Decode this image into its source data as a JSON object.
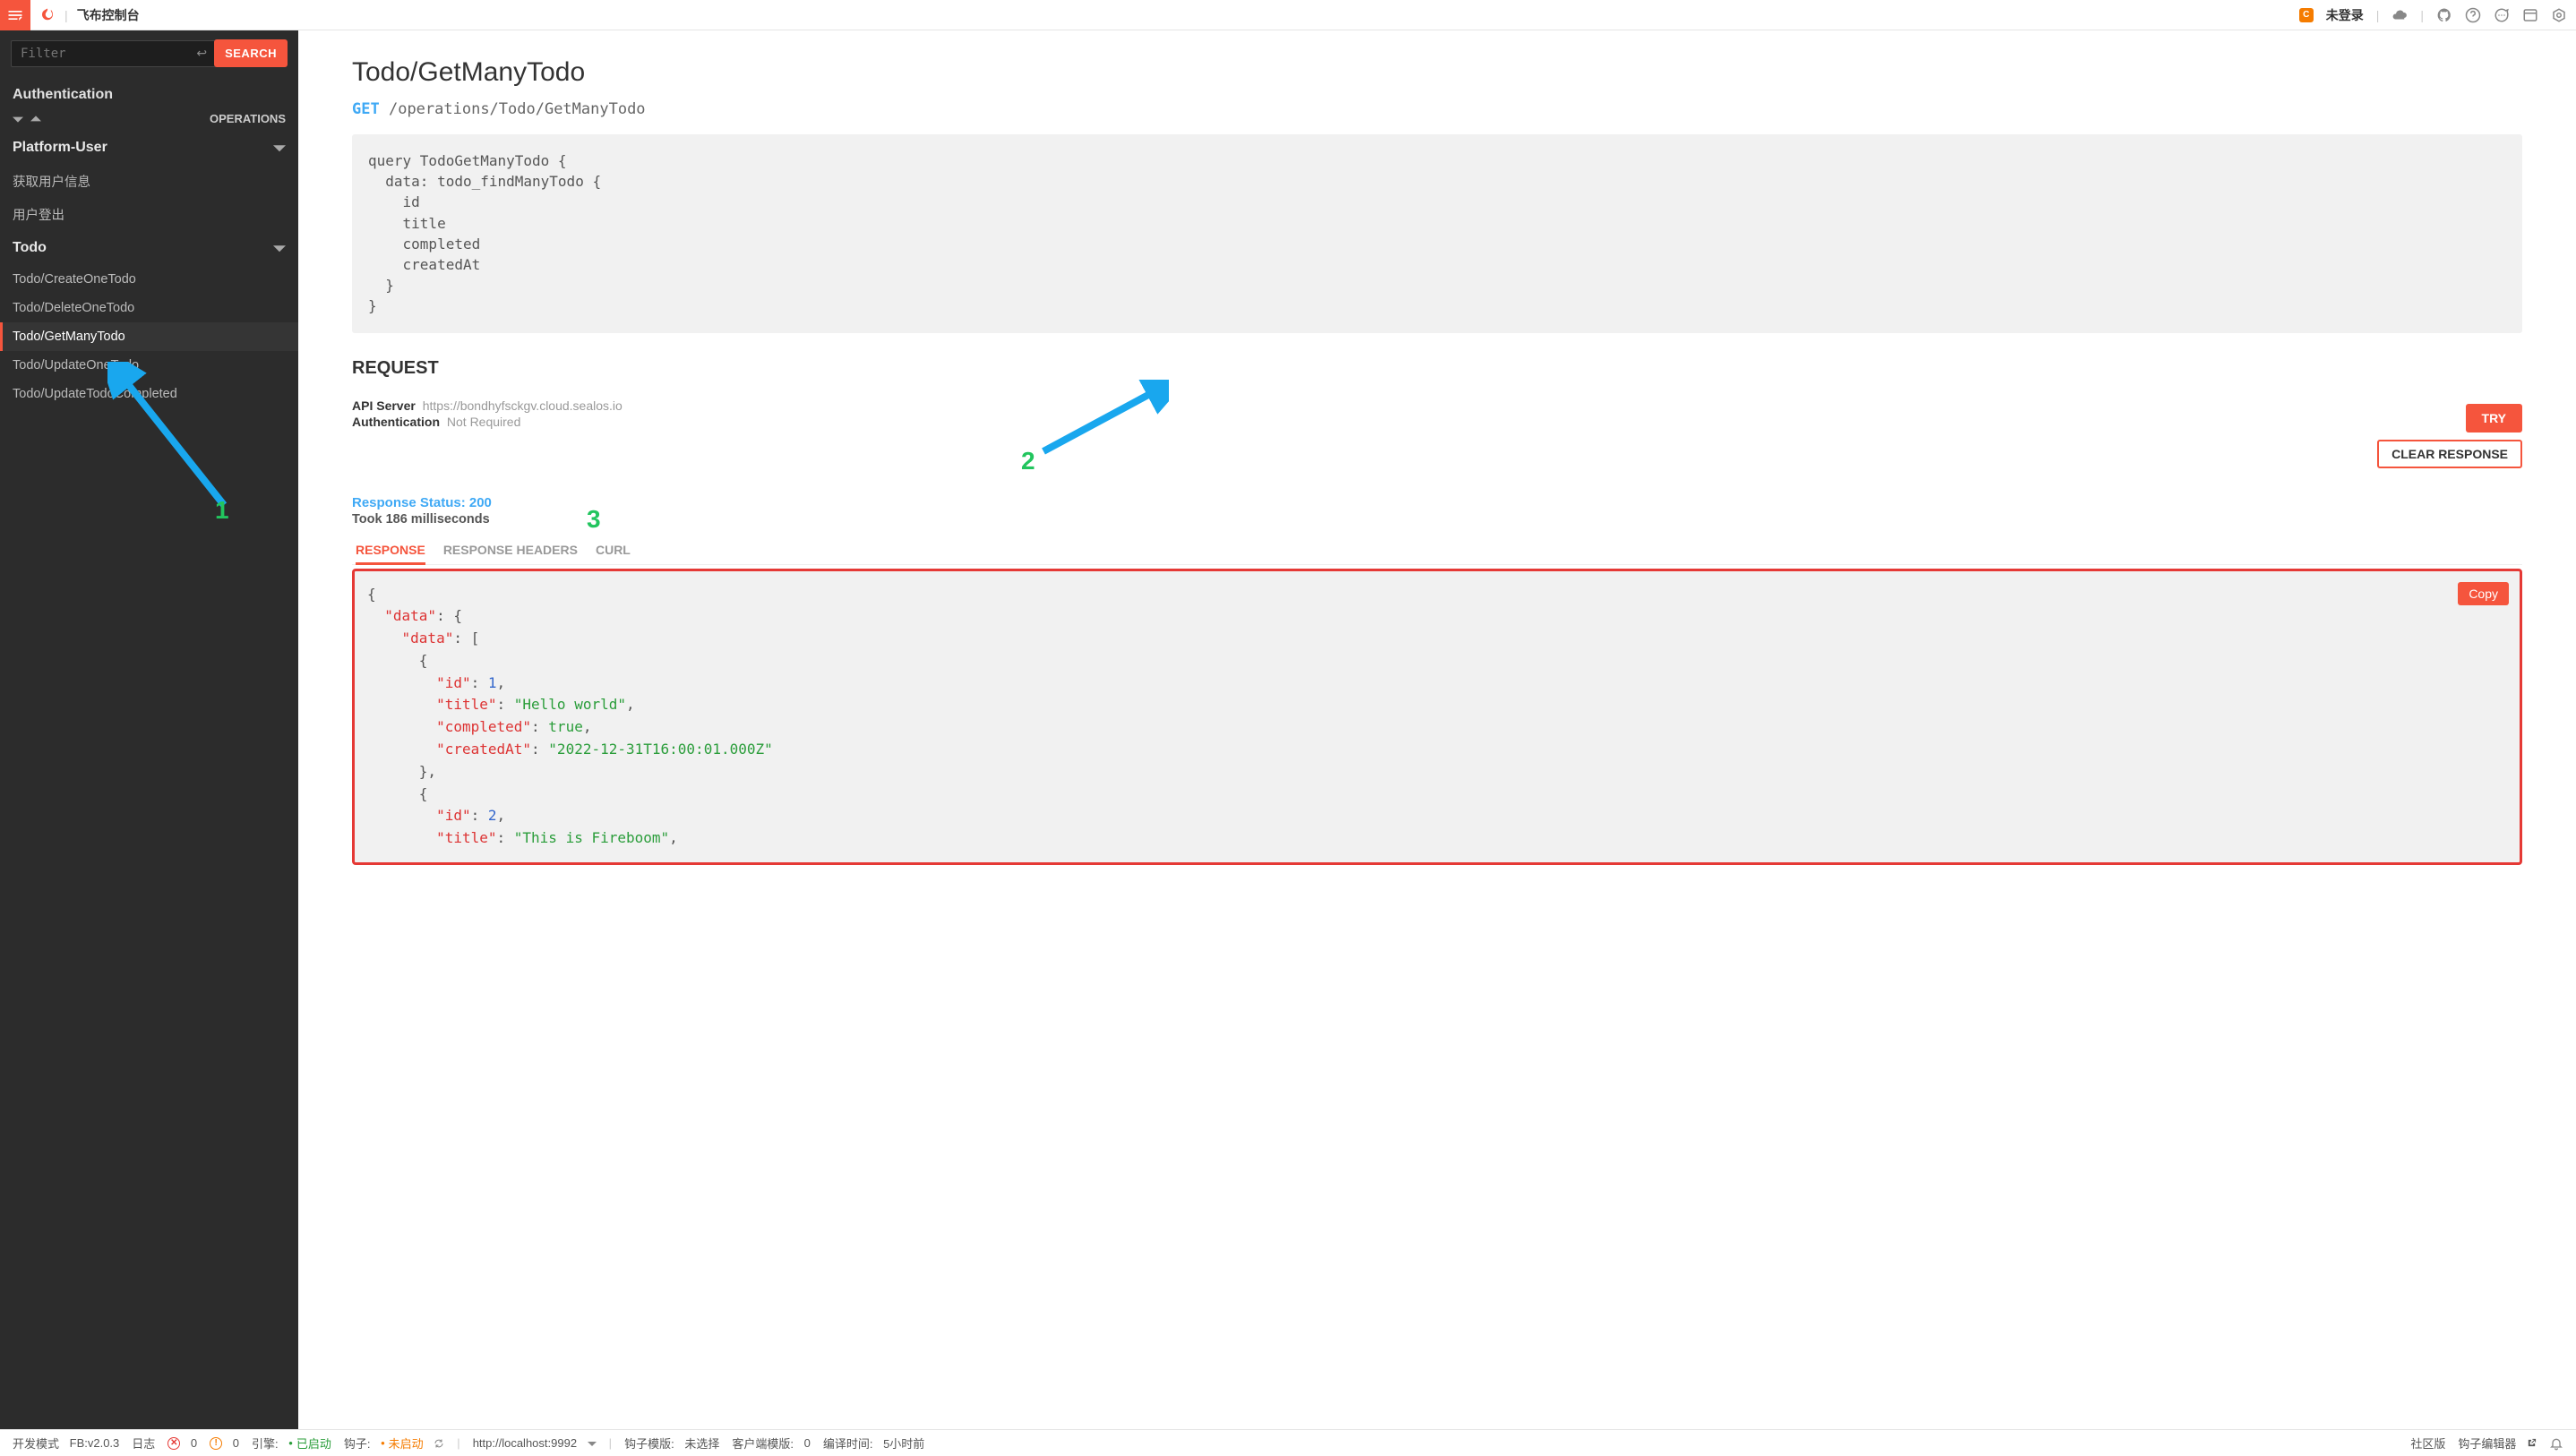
{
  "topbar": {
    "title": "飞布控制台",
    "login_status": "未登录"
  },
  "sidebar": {
    "filter_placeholder": "Filter",
    "search_label": "SEARCH",
    "auth_heading": "Authentication",
    "operations_label": "OPERATIONS",
    "groups": [
      {
        "name": "Platform-User",
        "items": [
          "获取用户信息",
          "用户登出"
        ]
      },
      {
        "name": "Todo",
        "items": [
          "Todo/CreateOneTodo",
          "Todo/DeleteOneTodo",
          "Todo/GetManyTodo",
          "Todo/UpdateOneTodo",
          "Todo/UpdateTodoCompleted"
        ],
        "active_index": 2
      }
    ]
  },
  "main": {
    "page_title": "Todo/GetManyTodo",
    "method": "GET",
    "path": "/operations/Todo/GetManyTodo",
    "query_code": "query TodoGetManyTodo {\n  data: todo_findManyTodo {\n    id\n    title\n    completed\n    createdAt\n  }\n}",
    "request_heading": "REQUEST",
    "api_server_label": "API Server",
    "api_server_value": "https://bondhyfsckgv.cloud.sealos.io",
    "auth_label": "Authentication",
    "auth_value": "Not Required",
    "try_label": "TRY",
    "clear_label": "CLEAR RESPONSE",
    "response_status": "Response Status: 200",
    "took": "Took 186 milliseconds",
    "tabs": {
      "response": "RESPONSE",
      "headers": "RESPONSE HEADERS",
      "curl": "CURL"
    },
    "copy_label": "Copy",
    "response_json": {
      "data": {
        "data": [
          {
            "id": 1,
            "title": "Hello world",
            "completed": true,
            "createdAt": "2022-12-31T16:00:01.000Z"
          },
          {
            "id": 2,
            "title": "This is Fireboom"
          }
        ]
      }
    }
  },
  "annotations": {
    "n1": "1",
    "n2": "2",
    "n3": "3"
  },
  "footer": {
    "mode_label": "开发模式",
    "version": "FB:v2.0.3",
    "log_label": "日志",
    "err_count": "0",
    "warn_count": "0",
    "engine_label": "引擎:",
    "engine_status": "已启动",
    "hook_label": "钩子:",
    "hook_status": "未启动",
    "hook_url": "http://localhost:9992",
    "hook_tpl_label": "钩子模版:",
    "hook_tpl_value": "未选择",
    "client_tpl_label": "客户端模版:",
    "client_tpl_value": "0",
    "compile_label": "编译时间:",
    "compile_value": "5小时前",
    "community": "社区版",
    "editor": "钩子编辑器"
  }
}
